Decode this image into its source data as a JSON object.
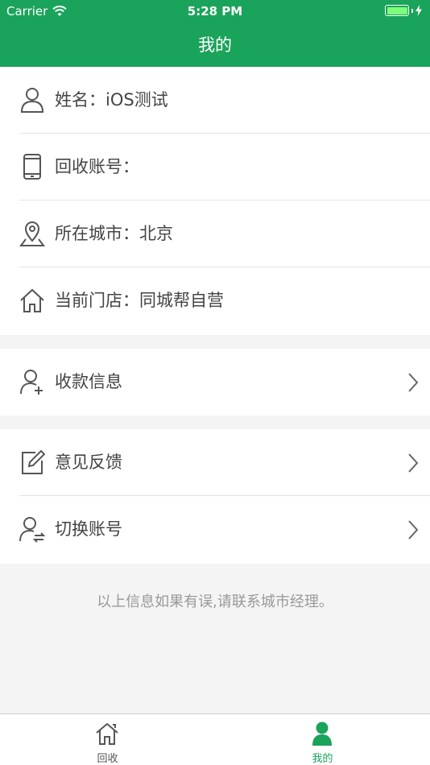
{
  "status_bar": {
    "carrier": "Carrier",
    "time": "5:28 PM"
  },
  "nav": {
    "title": "我的"
  },
  "profile": {
    "items": [
      {
        "label": "姓名：iOS测试",
        "icon": "user-icon"
      },
      {
        "label": "回收账号：",
        "icon": "phone-icon"
      },
      {
        "label": "所在城市：北京",
        "icon": "location-icon"
      },
      {
        "label": "当前门店：同城帮自营",
        "icon": "home-icon"
      }
    ]
  },
  "payment": {
    "label": "收款信息",
    "icon": "user-add-icon"
  },
  "actions": {
    "feedback_label": "意见反馈",
    "switch_label": "切换账号"
  },
  "footer_note": "以上信息如果有误,请联系城市经理。",
  "tabbar": {
    "tabs": [
      {
        "label": "回收",
        "active": false
      },
      {
        "label": "我的",
        "active": true
      }
    ]
  },
  "colors": {
    "brand": "#1aa35a",
    "icon": "#555555",
    "inactive_tab": "#555555"
  }
}
